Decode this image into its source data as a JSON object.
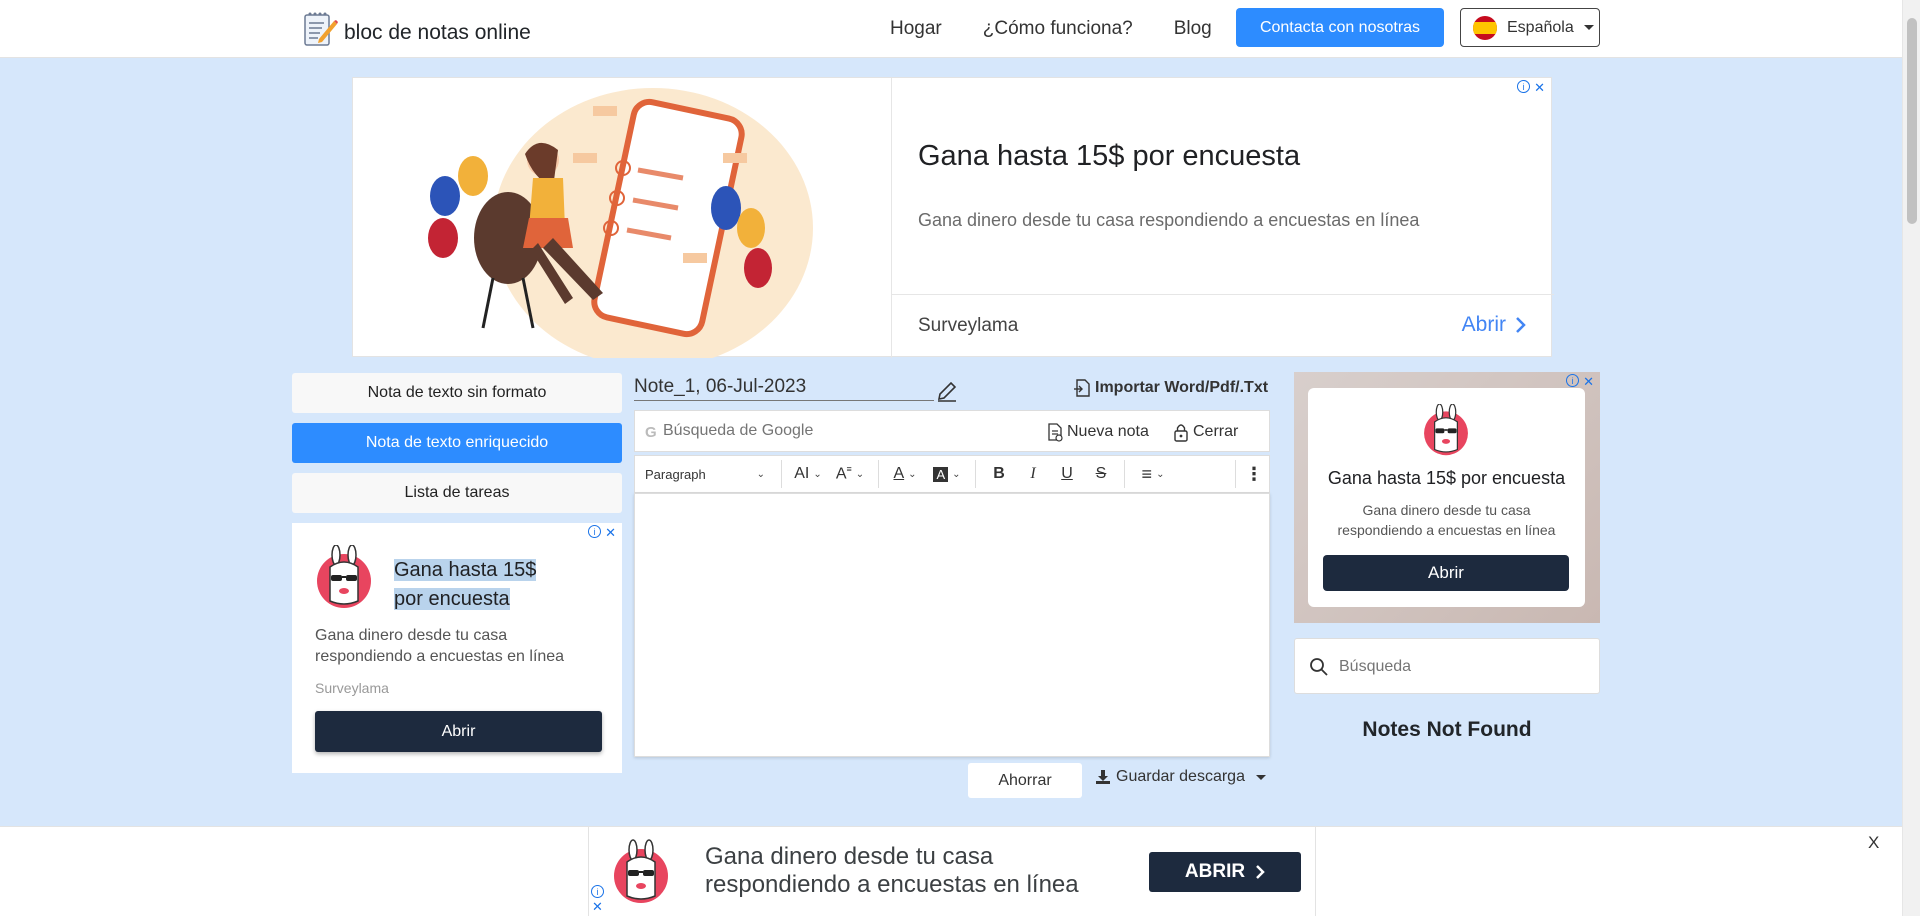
{
  "nav": {
    "logo_text": "bloc de notas online",
    "links": [
      "Hogar",
      "¿Cómo funciona?",
      "Blog"
    ],
    "contact_label": "Contacta con nosotras",
    "language_label": "Española"
  },
  "banner_ad": {
    "title": "Gana hasta 15$ por encuesta",
    "description": "Gana dinero desde tu casa respondiendo a encuestas en línea",
    "brand": "Surveylama",
    "open_label": "Abrir"
  },
  "sidebar": {
    "items": [
      {
        "label": "Nota de texto sin formato",
        "active": false
      },
      {
        "label": "Nota de texto enriquecido",
        "active": true
      },
      {
        "label": "Lista de tareas",
        "active": false
      }
    ]
  },
  "left_ad": {
    "title_line1": "Gana hasta 15$",
    "title_line2": "por encuesta",
    "description": "Gana dinero desde tu casa respondiendo a encuestas en línea",
    "brand": "Surveylama",
    "button_label": "Abrir"
  },
  "editor": {
    "note_title": "Note_1, 06-Jul-2023",
    "import_label": "Importar Word/Pdf/.Txt",
    "search_placeholder": "Búsqueda de Google",
    "new_note_label": "Nueva nota",
    "close_label": "Cerrar",
    "paragraph_label": "Paragraph",
    "save_label": "Ahorrar",
    "download_label": "Guardar descarga"
  },
  "right_ad": {
    "title": "Gana hasta 15$ por encuesta",
    "description_line1": "Gana dinero desde tu casa",
    "description_line2": "respondiendo a encuestas en línea",
    "button_label": "Abrir"
  },
  "right_panel": {
    "search_placeholder": "Búsqueda",
    "empty_label": "Notes Not Found"
  },
  "bottom_ad": {
    "line1": "Gana dinero desde tu casa",
    "line2": "respondiendo a encuestas en línea",
    "button_label": "ABRIR",
    "close_label": "X"
  },
  "colors": {
    "accent": "#2d8cff",
    "page_bg": "#d6e7fb",
    "ad_button": "#1d2a3e"
  }
}
